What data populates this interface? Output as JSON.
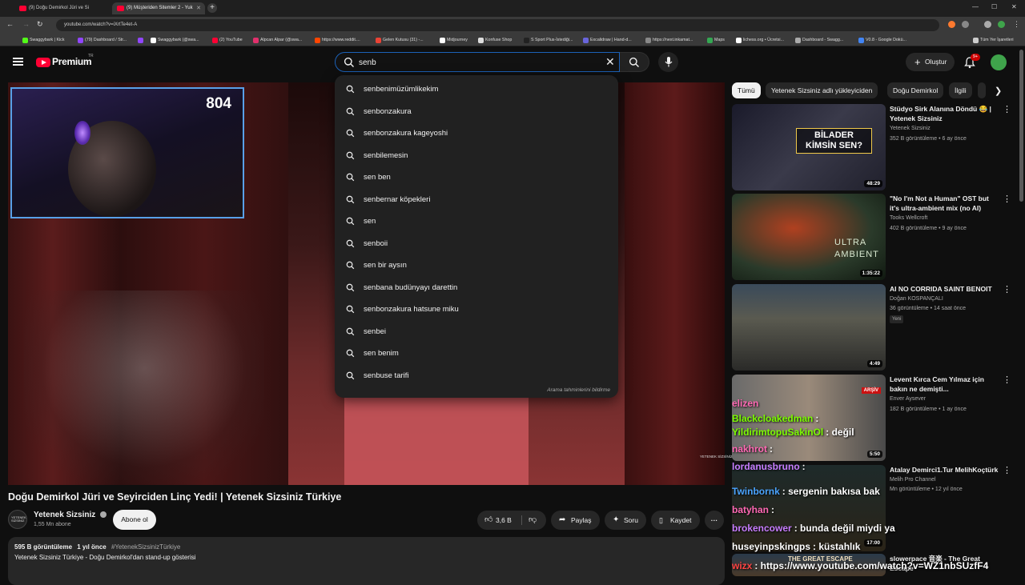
{
  "browser": {
    "tabs": [
      {
        "label": "(9) Doğu Demirkol Jüri ve Si"
      },
      {
        "label": "(9) Müşteriden Sitemler 2 - Yuk"
      }
    ],
    "url": "youtube.com/watch?v=iXrtTe4et-A",
    "bookmarks": [
      {
        "label": "Swaggybark | Kick",
        "color": "#53fc18"
      },
      {
        "label": "(79) Dashboard / Str...",
        "color": "#9146ff"
      },
      {
        "label": "",
        "color": "#9146ff"
      },
      {
        "label": "Swaggybark (@swa...",
        "color": "#ffffff"
      },
      {
        "label": "(2) YouTube",
        "color": "#ff0033"
      },
      {
        "label": "Alpcan Alpar (@swa...",
        "color": "#e1306c"
      },
      {
        "label": "https://www.reddit....",
        "color": "#ff4500"
      },
      {
        "label": "Gelen Kutusu (31) -...",
        "color": "#ea4335"
      },
      {
        "label": "Midjourney",
        "color": "#ffffff"
      },
      {
        "label": "Konfuse Shop",
        "color": "#dddddd"
      },
      {
        "label": "S Sport Plus-İstediği...",
        "color": "#222222"
      },
      {
        "label": "Excalidraw | Hand-d...",
        "color": "#6965db"
      },
      {
        "label": "https://next.inkamat...",
        "color": "#888888"
      },
      {
        "label": "Maps",
        "color": "#34a853"
      },
      {
        "label": "lichess.org • Ücretsi...",
        "color": "#ffffff"
      },
      {
        "label": "Dashboard - Swagg...",
        "color": "#aaaaaa"
      },
      {
        "label": "V0.8 - Google Dokü...",
        "color": "#4285f4"
      }
    ],
    "all_bookmarks": "Tüm Yer İşaretleri"
  },
  "header": {
    "logo": "Premium",
    "region": "TR",
    "search_value": "senb",
    "create_label": "Oluştur",
    "notification_count": "9+"
  },
  "suggestions": [
    "senbenimüzümlikekim",
    "senbonzakura",
    "senbonzakura kageyoshi",
    "senbilemesin",
    "sen ben",
    "senbernar köpekleri",
    "sen",
    "senboii",
    "sen bir aysın",
    "senbana budünyayı darettin",
    "senbonzakura hatsune miku",
    "senbei",
    "sen benim",
    "senbuse tarifi"
  ],
  "suggest_report": "Arama tahminlerini bildirme",
  "player": {
    "webcam_count": "804",
    "watermark": "YETENEK SİZSİNİZ"
  },
  "video": {
    "title": "Doğu Demirkol Jüri ve Seyirciden Linç Yedi! | Yetenek Sizsiniz Türkiye",
    "channel": "Yetenek Sizsiniz",
    "subscribers": "1,55 Mn abone",
    "subscribe_label": "Abone ol",
    "likes": "3,6 B",
    "share_label": "Paylaş",
    "ask_label": "Soru",
    "save_label": "Kaydet",
    "views": "595 B görüntüleme",
    "age": "1 yıl önce",
    "hashtag": "#YetenekSizsinizTürkiye",
    "description": "Yetenek Sizsiniz Türkiye - Doğu Demirkol'dan stand-up gösterisi"
  },
  "chips": [
    "Tümü",
    "Yetenek Sizsiniz adlı yükleyiciden",
    "Doğu Demirkol",
    "İlgili"
  ],
  "recommendations": [
    {
      "title": "Stüdyo Sirk Alanına Döndü 😂 | Yetenek Sizsiniz",
      "channel": "Yetenek Sizsiniz",
      "meta": "352 B görüntüleme • 6 ay önce",
      "duration": "48:29",
      "thumb_text": "BİLADER KİMSİN SEN?"
    },
    {
      "title": "\"No I'm Not a Human\" OST but it's ultra-ambient mix (no AI)",
      "channel": "Tooks Wellcroft",
      "meta": "402 B görüntüleme • 9 ay önce",
      "duration": "1:35:22",
      "thumb_text": "ULTRA AMBIENT"
    },
    {
      "title": "AI NO CORRIDA SAINT BENOIT",
      "channel": "Doğan KOSPANÇALI",
      "meta": "36 görüntüleme • 14 saat önce",
      "duration": "4:49",
      "badge": "Yeni"
    },
    {
      "title": "Levent Kırca Cem Yılmaz için bakın ne demişti...",
      "channel": "Enver Aysever",
      "meta": "182 B görüntüleme • 1 ay önce",
      "duration": "5:50",
      "thumb_text": "ARŞİV"
    },
    {
      "title": "Atalay Demirci1.Tur  MelihKoçtürk",
      "channel": "Melih Pro Channel",
      "meta": "Mn görüntüleme • 12 yıl önce",
      "duration": "17:00"
    },
    {
      "title": "slowerpace 音楽 - The Great Escape",
      "channel": "",
      "meta": "",
      "duration": "",
      "thumb_text": "THE GREAT ESCAPE"
    }
  ],
  "chat_overlay": [
    {
      "user": "elizen",
      "msg": "",
      "color": "#ff69b4"
    },
    {
      "user": "Blackcloakedman",
      "msg": ":",
      "color": "#7cfc00"
    },
    {
      "user": "YildirimtopuSakinOl",
      "msg": ": değil",
      "color": "#7cfc00"
    },
    {
      "user": "nakhrot",
      "msg": ":",
      "color": "#ff69b4"
    },
    {
      "user": "lordanusbruno",
      "msg": ":",
      "color": "#c77dff"
    },
    {
      "user": "Twinbornk",
      "msg": ": sergenin bakısa bak",
      "color": "#4aa3ff"
    },
    {
      "user": "batyhan",
      "msg": ":",
      "color": "#ff69b4"
    },
    {
      "user": "brokencower",
      "msg": ": bunda değil miydi ya",
      "color": "#c77dff"
    },
    {
      "user": "huseyinpskingps",
      "msg": ": küstahlık",
      "color": "#ffffff"
    },
    {
      "user": "wizx",
      "msg": ": https://www.youtube.com/watch?v=WZ1nbSUzfF4",
      "color": "#ff4444"
    }
  ]
}
